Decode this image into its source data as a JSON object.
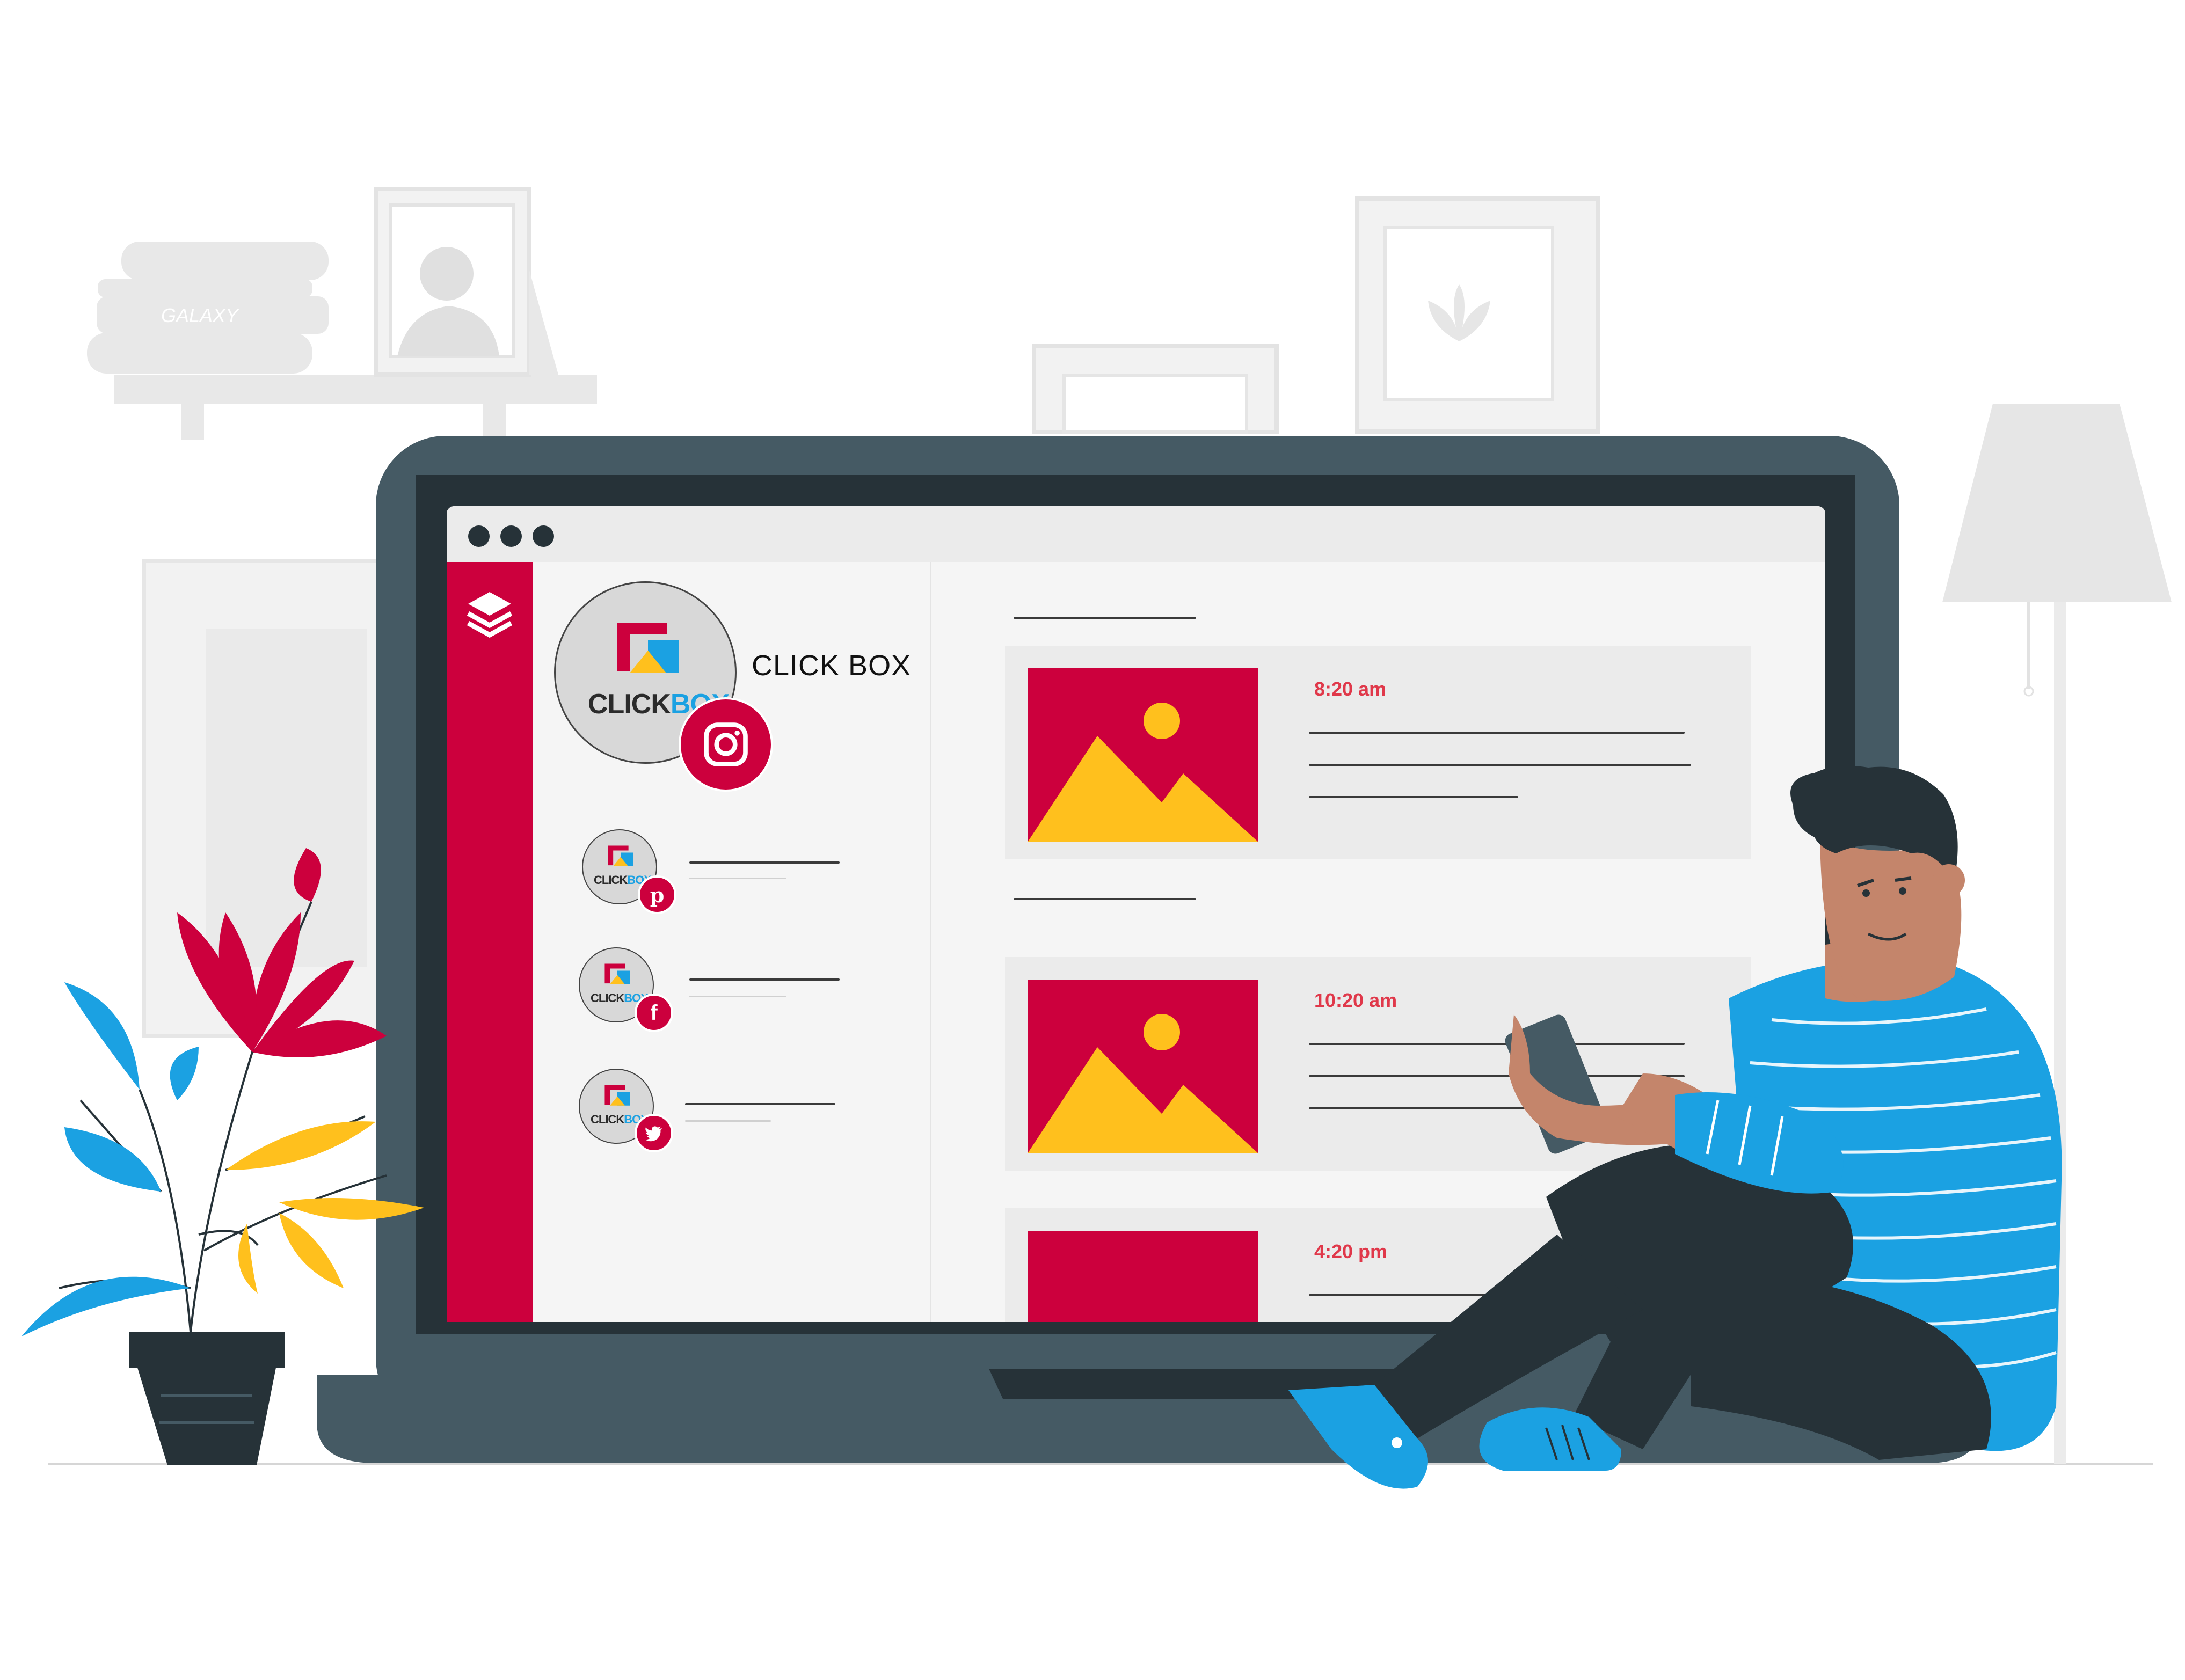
{
  "profile": {
    "name": "CLICK BOX",
    "logo_text_part1": "CLICK",
    "logo_text_part2": "BOX",
    "main_network_icon": "instagram-icon"
  },
  "accounts": [
    {
      "network": "pinterest",
      "icon": "pinterest-icon",
      "badge_glyph": "p"
    },
    {
      "network": "facebook",
      "icon": "facebook-icon",
      "badge_glyph": "f"
    },
    {
      "network": "twitter",
      "icon": "twitter-icon",
      "badge_glyph": "t"
    }
  ],
  "posts": [
    {
      "time": "8:20 am"
    },
    {
      "time": "10:20 am"
    },
    {
      "time": "4:20 pm"
    }
  ],
  "background": {
    "book_spine_text": "GALAXY"
  },
  "colors": {
    "brand_red": "#cc003d",
    "accent_blue": "#1ba1e2",
    "time_red": "#e0384a",
    "laptop_frame": "#455a64",
    "laptop_bezel": "#263238",
    "sun_yellow": "#ffc01d"
  }
}
